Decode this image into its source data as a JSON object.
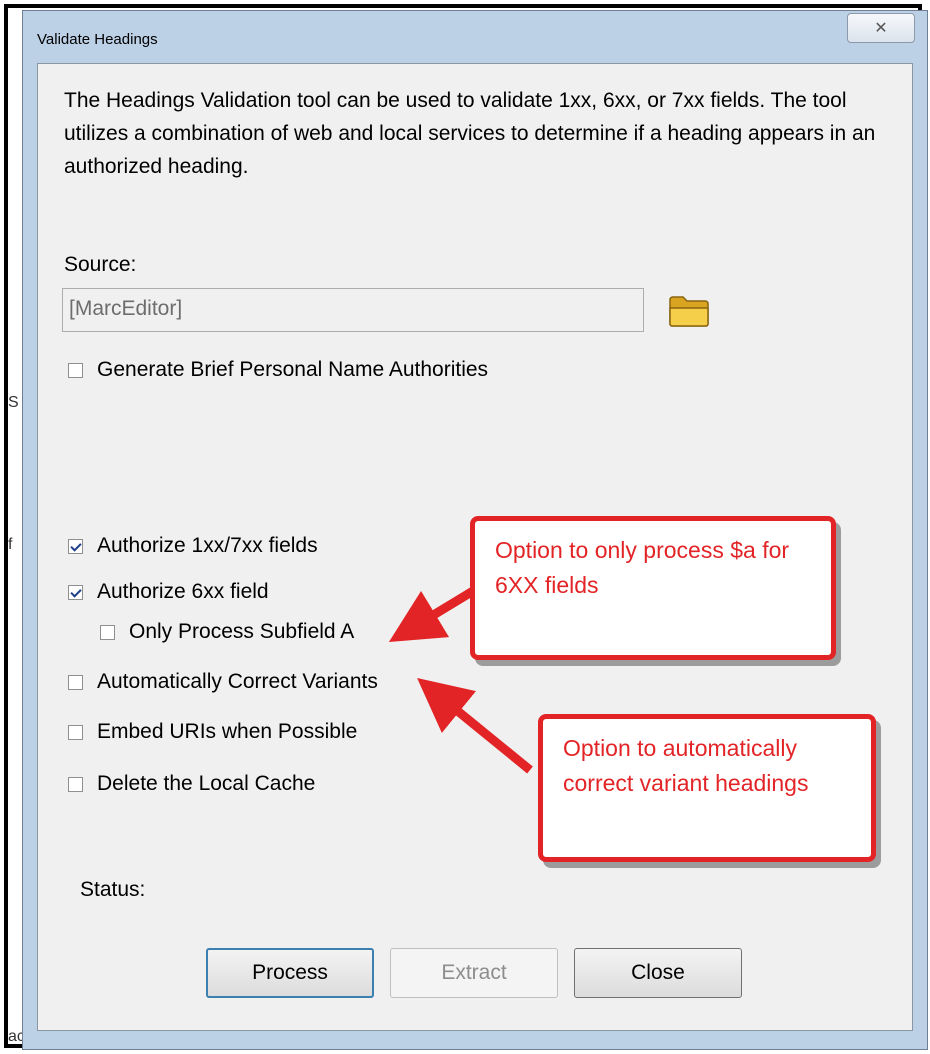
{
  "window": {
    "title": "Validate Headings",
    "close_symbol": "✕"
  },
  "description": "The Headings Validation tool can be used to validate 1xx, 6xx, or 7xx fields.  The tool utilizes a combination of web and local services to determine if a heading appears in an authorized heading.",
  "source": {
    "label": "Source:",
    "value": "[MarcEditor]",
    "browse_icon": "folder-icon"
  },
  "options": {
    "generate_brief": {
      "label": "Generate Brief Personal Name Authorities",
      "checked": false
    },
    "authorize_1xx_7xx": {
      "label": "Authorize 1xx/7xx fields",
      "checked": true
    },
    "authorize_6xx": {
      "label": "Authorize 6xx field",
      "checked": true
    },
    "only_subfield_a": {
      "label": "Only Process Subfield A",
      "checked": false
    },
    "auto_correct": {
      "label": "Automatically Correct Variants",
      "checked": false
    },
    "embed_uris": {
      "label": "Embed URIs when Possible",
      "checked": false
    },
    "delete_cache": {
      "label": "Delete the Local Cache",
      "checked": false
    }
  },
  "status": {
    "label": "Status:"
  },
  "buttons": {
    "process": "Process",
    "extract": "Extract",
    "close": "Close"
  },
  "annotations": {
    "callout1": "Option to only process $a for 6XX fields",
    "callout2": "Option to automatically correct variant headings",
    "color": "#e32426"
  },
  "background_fragments": [
    "S",
    "f",
    "ac"
  ]
}
